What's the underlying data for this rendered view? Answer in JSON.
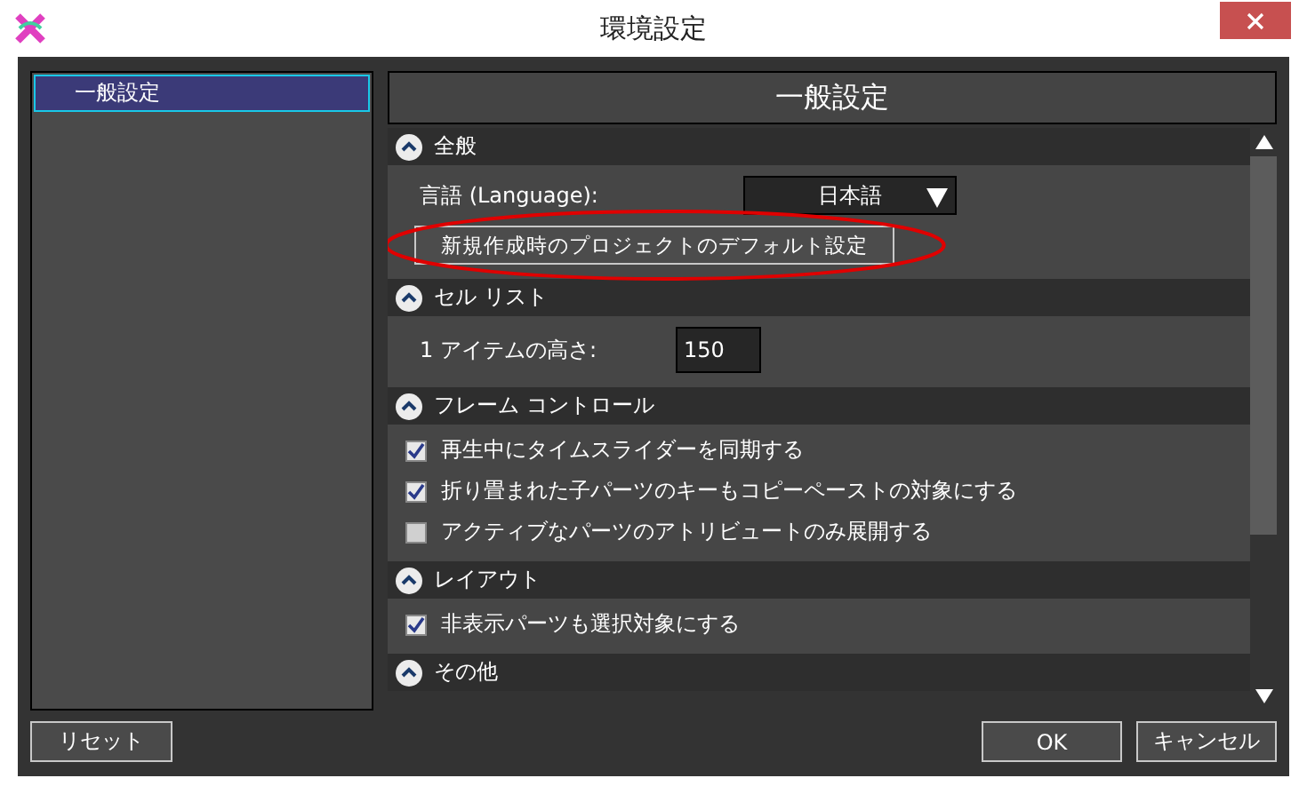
{
  "window": {
    "title": "環境設定"
  },
  "sidebar": {
    "items": [
      {
        "label": "一般設定",
        "selected": true
      }
    ]
  },
  "panel": {
    "title": "一般設定"
  },
  "sections": [
    {
      "title": "全般",
      "expanded": true,
      "items": [
        {
          "kind": "dropdown",
          "label": "言語 (Language):",
          "value": "日本語"
        },
        {
          "kind": "button",
          "label": "新規作成時のプロジェクトのデフォルト設定",
          "highlighted": true
        }
      ]
    },
    {
      "title": "セル リスト",
      "expanded": true,
      "items": [
        {
          "kind": "field",
          "label": "1 アイテムの高さ:",
          "value": "150"
        }
      ]
    },
    {
      "title": "フレーム コントロール",
      "expanded": true,
      "items": [
        {
          "kind": "checkbox",
          "label": "再生中にタイムスライダーを同期する",
          "checked": true
        },
        {
          "kind": "checkbox",
          "label": "折り畳まれた子パーツのキーもコピーペーストの対象にする",
          "checked": true
        },
        {
          "kind": "checkbox",
          "label": "アクティブなパーツのアトリビュートのみ展開する",
          "checked": false
        }
      ]
    },
    {
      "title": "レイアウト",
      "expanded": true,
      "items": [
        {
          "kind": "checkbox",
          "label": "非表示パーツも選択対象にする",
          "checked": true
        }
      ]
    },
    {
      "title": "その他",
      "expanded": true
    }
  ],
  "buttons": {
    "reset": "リセット",
    "ok": "OK",
    "cancel": "キャンセル"
  }
}
